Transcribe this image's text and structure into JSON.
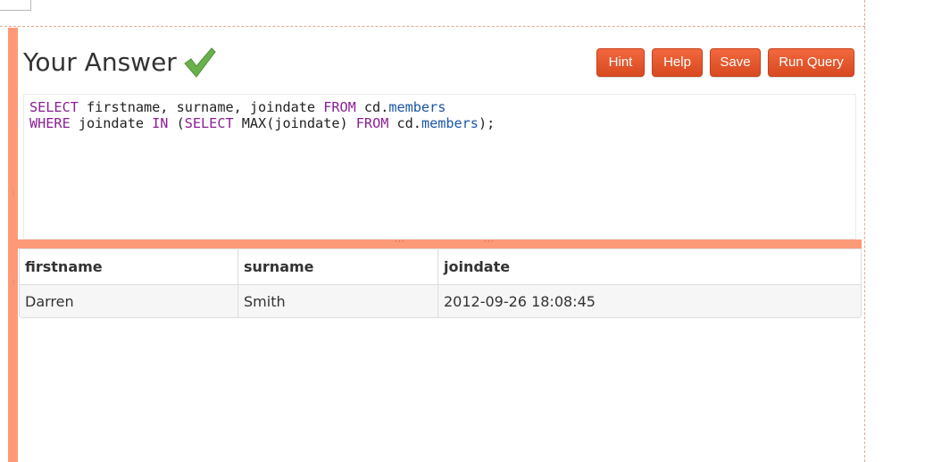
{
  "header": {
    "title": "Your Answer"
  },
  "icons": {
    "correct": "checkmark-icon"
  },
  "toolbar": {
    "hint_label": "Hint",
    "help_label": "Help",
    "save_label": "Save",
    "run_label": "Run Query"
  },
  "editor": {
    "line1": {
      "kw_select": "SELECT",
      "cols": " firstname, surname, joindate ",
      "kw_from": "FROM",
      "schema": " cd.",
      "table": "members"
    },
    "line2": {
      "kw_where": "WHERE",
      "col": " joindate ",
      "kw_in": "IN",
      "open": " (",
      "kw_select": "SELECT",
      "func": " MAX(joindate) ",
      "kw_from": "FROM",
      "schema": " cd.",
      "table": "members",
      "close": ");"
    }
  },
  "results": {
    "columns": [
      "firstname",
      "surname",
      "joindate"
    ],
    "rows": [
      [
        "Darren",
        "Smith",
        "2012-09-26 18:08:45"
      ]
    ]
  },
  "colors": {
    "accent": "#fc9a78",
    "button": "#e0552a",
    "keyword": "#8a1f94",
    "table_name": "#1b55a6",
    "check": "#6ab04c"
  }
}
